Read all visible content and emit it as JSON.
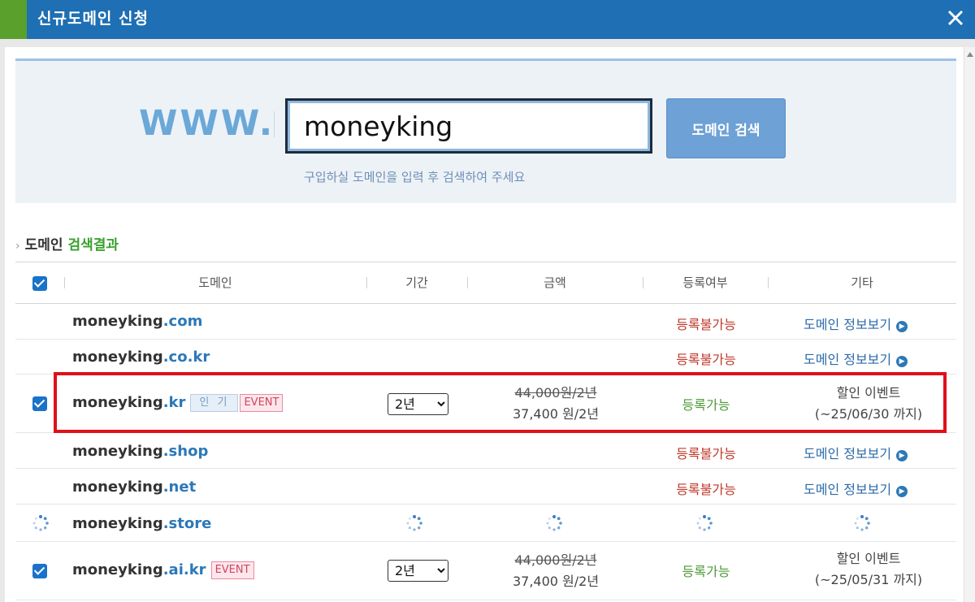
{
  "window": {
    "title": "신규도메인 신청",
    "close_icon": "close-icon"
  },
  "search": {
    "prefix": "WWW.",
    "value": "moneyking",
    "button_label": "도메인 검색",
    "hint": "구입하실 도메인을 입력 후 검색하여 주세요"
  },
  "results": {
    "heading_prefix": "도메인",
    "heading_highlight": "검색결과",
    "columns": {
      "domain": "도메인",
      "period": "기간",
      "price": "금액",
      "status": "등록여부",
      "etc": "기타"
    },
    "rows": [
      {
        "name": "moneyking",
        "tld": ".com",
        "status": "등록불가능",
        "link": "도메인 정보보기"
      },
      {
        "name": "moneyking",
        "tld": ".co.kr",
        "status": "등록불가능",
        "link": "도메인 정보보기"
      },
      {
        "name": "moneyking",
        "tld": ".kr",
        "badge_popular": "인 기",
        "badge_event": "EVENT",
        "period": "2년",
        "old_price": "44,000원/2년",
        "new_price": "37,400 원/2년",
        "status": "등록가능",
        "etc_line1": "할인 이벤트",
        "etc_line2": "(~25/06/30 까지)"
      },
      {
        "name": "moneyking",
        "tld": ".shop",
        "status": "등록불가능",
        "link": "도메인 정보보기"
      },
      {
        "name": "moneyking",
        "tld": ".net",
        "status": "등록불가능",
        "link": "도메인 정보보기"
      },
      {
        "name": "moneyking",
        "tld": ".store"
      },
      {
        "name": "moneyking",
        "tld": ".ai.kr",
        "badge_event": "EVENT",
        "period": "2년",
        "old_price": "44,000원/2년",
        "new_price": "37,400 원/2년",
        "status": "등록가능",
        "etc_line1": "할인 이벤트",
        "etc_line2": "(~25/05/31 까지)"
      }
    ]
  },
  "colors": {
    "titlebar": "#1e6fb3",
    "accent_green": "#5aa02c",
    "unavailable": "#c0392b",
    "available": "#4e9a3a",
    "highlight": "#e0101a"
  }
}
